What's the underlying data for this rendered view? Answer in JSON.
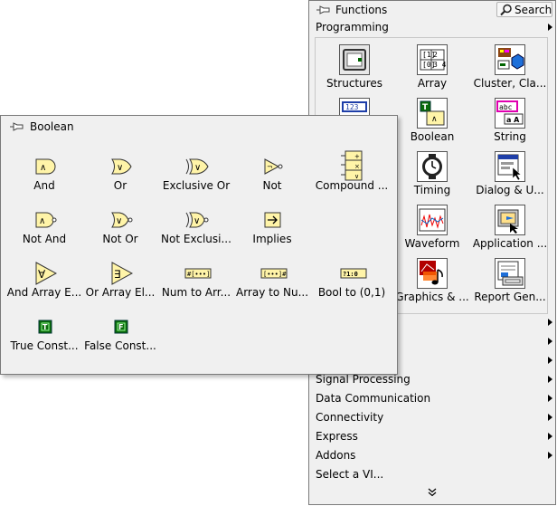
{
  "functions": {
    "title": "Functions",
    "search_label": "Search",
    "category": "Programming",
    "grid": [
      {
        "label": "Structures",
        "icon": "structures-icon"
      },
      {
        "label": "Array",
        "icon": "array-icon"
      },
      {
        "label": "Cluster, Cla...",
        "icon": "cluster-icon"
      },
      {
        "label": "",
        "icon": "numeric-icon"
      },
      {
        "label": "Boolean",
        "icon": "boolean-icon"
      },
      {
        "label": "String",
        "icon": "string-icon"
      },
      {
        "label": "",
        "icon": "comparison-icon"
      },
      {
        "label": "Timing",
        "icon": "timing-icon"
      },
      {
        "label": "Dialog & U...",
        "icon": "dialog-icon"
      },
      {
        "label": "",
        "icon": "file-io-icon"
      },
      {
        "label": "Waveform",
        "icon": "waveform-icon"
      },
      {
        "label": "Application ...",
        "icon": "application-control-icon"
      },
      {
        "label": "",
        "icon": "synchronization-icon"
      },
      {
        "label": "Graphics & ...",
        "icon": "graphics-sound-icon"
      },
      {
        "label": "Report Gen...",
        "icon": "report-generation-icon"
      }
    ],
    "subpalettes": [
      {
        "label": "",
        "has_arrow": true
      },
      {
        "label": "",
        "has_arrow": true
      },
      {
        "label": "",
        "has_arrow": true
      },
      {
        "label": "Signal Processing",
        "has_arrow": true
      },
      {
        "label": "Data Communication",
        "has_arrow": true
      },
      {
        "label": "Connectivity",
        "has_arrow": true
      },
      {
        "label": "Express",
        "has_arrow": true
      },
      {
        "label": "Addons",
        "has_arrow": true
      },
      {
        "label": "Select a VI...",
        "has_arrow": false
      }
    ]
  },
  "boolean": {
    "title": "Boolean",
    "items": [
      {
        "label": "And",
        "icon": "and-icon"
      },
      {
        "label": "Or",
        "icon": "or-icon"
      },
      {
        "label": "Exclusive Or",
        "icon": "exclusive-or-icon"
      },
      {
        "label": "Not",
        "icon": "not-icon"
      },
      {
        "label": "Compound ...",
        "icon": "compound-arithmetic-icon"
      },
      {
        "label": "Not And",
        "icon": "not-and-icon"
      },
      {
        "label": "Not Or",
        "icon": "not-or-icon"
      },
      {
        "label": "Not Exclusi...",
        "icon": "not-exclusive-or-icon"
      },
      {
        "label": "Implies",
        "icon": "implies-icon"
      },
      {
        "label": "",
        "icon": "blank"
      },
      {
        "label": "And Array E...",
        "icon": "and-array-elements-icon"
      },
      {
        "label": "Or Array El...",
        "icon": "or-array-elements-icon"
      },
      {
        "label": "Num to Arr...",
        "icon": "number-to-boolean-array-icon"
      },
      {
        "label": "Array to Nu...",
        "icon": "boolean-array-to-number-icon"
      },
      {
        "label": "Bool to (0,1)",
        "icon": "boolean-to-01-icon"
      },
      {
        "label": "True Const...",
        "icon": "true-constant-icon"
      },
      {
        "label": "False Const...",
        "icon": "false-constant-icon"
      }
    ]
  },
  "colors": {
    "palette_bg": "#f0f0f0",
    "border": "#7a7a7a",
    "bool_green": "#006400",
    "bool_fill": "#fff4a8"
  }
}
